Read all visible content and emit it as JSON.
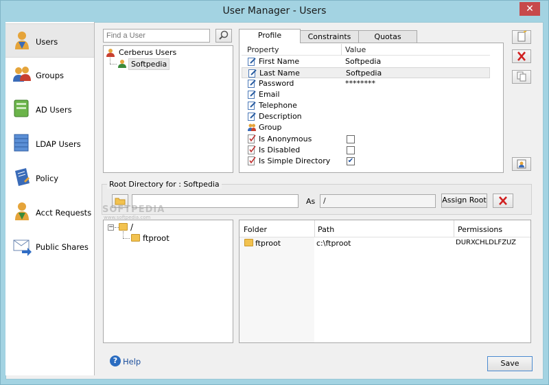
{
  "window": {
    "title": "User Manager - Users",
    "close_glyph": "✕"
  },
  "nav": [
    {
      "label": "Users",
      "icon": "user-icon",
      "selected": true
    },
    {
      "label": "Groups",
      "icon": "groups-icon"
    },
    {
      "label": "AD Users",
      "icon": "ad-users-icon"
    },
    {
      "label": "LDAP Users",
      "icon": "ldap-users-icon"
    },
    {
      "label": "Policy",
      "icon": "policy-icon"
    },
    {
      "label": "Acct Requests",
      "icon": "acct-requests-icon"
    },
    {
      "label": "Public Shares",
      "icon": "public-shares-icon"
    }
  ],
  "search": {
    "placeholder": "Find a User"
  },
  "user_tree": {
    "root": "Cerberus Users",
    "child": "Softpedia"
  },
  "tabs": [
    "Profile",
    "Constraints",
    "Quotas"
  ],
  "properties": {
    "header_property": "Property",
    "header_value": "Value",
    "rows": [
      {
        "name": "First Name",
        "value": "Softpedia"
      },
      {
        "name": "Last Name",
        "value": "Softpedia"
      },
      {
        "name": "Password",
        "value": "********"
      },
      {
        "name": "Email",
        "value": ""
      },
      {
        "name": "Telephone",
        "value": ""
      },
      {
        "name": "Description",
        "value": ""
      },
      {
        "name": "Group",
        "value": ""
      },
      {
        "name": "Is Anonymous",
        "checked": false
      },
      {
        "name": "Is Disabled",
        "checked": false
      },
      {
        "name": "Is Simple Directory",
        "checked": true
      }
    ]
  },
  "root_dir": {
    "group_label": "Root Directory for : Softpedia",
    "path_value": "",
    "as_label": "As",
    "as_value": "/",
    "assign_label": "Assign Root"
  },
  "dir_tree": {
    "root": "/",
    "child": "ftproot"
  },
  "folders_table": {
    "headers": [
      "Folder",
      "Path",
      "Permissions"
    ],
    "rows": [
      {
        "folder": "ftproot",
        "path": "c:\\ftproot",
        "permissions": "DURXCHLDLFZUZ"
      }
    ]
  },
  "watermark": {
    "text": "SOFTPEDIA",
    "url": "www.softpedia.com"
  },
  "footer": {
    "help_label": "Help",
    "save_label": "Save"
  },
  "colors": {
    "accent": "#1c4f9c",
    "delete_red": "#d02020",
    "folder": "#f2c24f"
  }
}
